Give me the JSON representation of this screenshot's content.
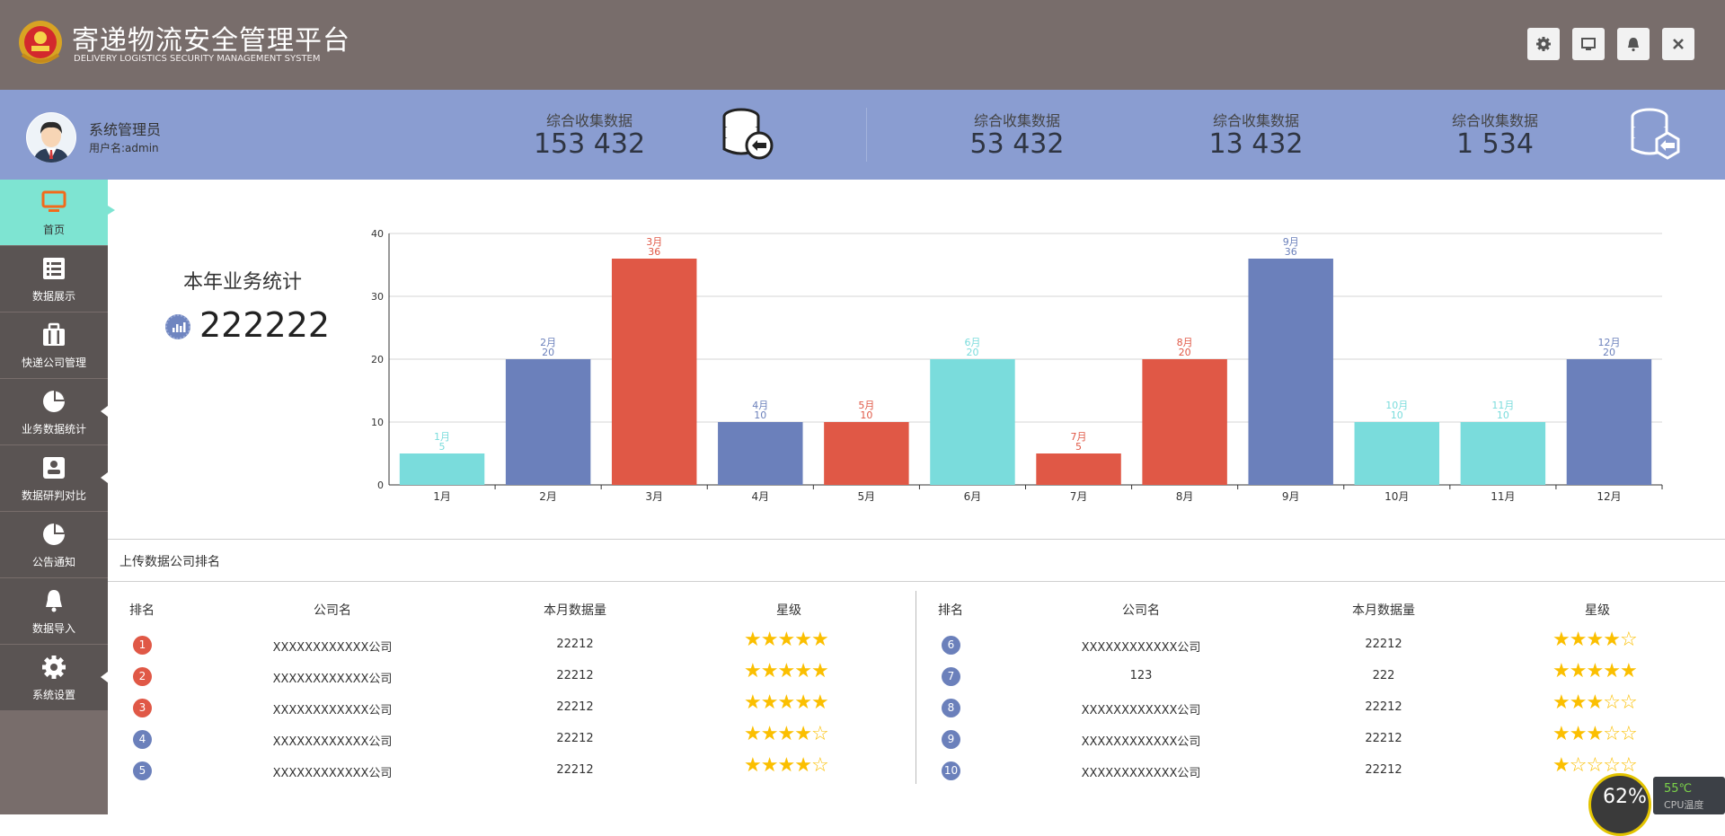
{
  "header": {
    "title": "寄递物流安全管理平台",
    "subtitle": "DELIVERY LOGISTICS SECURITY MANAGEMENT SYSTEM",
    "buttons": [
      "gear-icon",
      "monitor-icon",
      "bell-icon",
      "close-icon"
    ]
  },
  "user": {
    "name": "系统管理员",
    "login": "用户名:admin"
  },
  "stats": [
    {
      "label": "综合收集数据",
      "value": "153 432"
    },
    {
      "label": "综合收集数据",
      "value": "53 432"
    },
    {
      "label": "综合收集数据",
      "value": "13 432"
    },
    {
      "label": "综合收集数据",
      "value": "1 534"
    }
  ],
  "sidebar": {
    "items": [
      {
        "label": "首页",
        "icon": "monitor-icon",
        "active": true
      },
      {
        "label": "数据展示",
        "icon": "list-icon"
      },
      {
        "label": "快递公司管理",
        "icon": "briefcase-icon"
      },
      {
        "label": "业务数据统计",
        "icon": "pie-chart-icon"
      },
      {
        "label": "数据研判对比",
        "icon": "data-compare-icon"
      },
      {
        "label": "公告通知",
        "icon": "pie-chart-icon"
      },
      {
        "label": "数据导入",
        "icon": "bell-icon"
      },
      {
        "label": "系统设置",
        "icon": "gear-icon"
      }
    ]
  },
  "year_stats": {
    "title": "本年业务统计",
    "value": "222222"
  },
  "chart_data": {
    "type": "bar",
    "categories": [
      "1月",
      "2月",
      "3月",
      "4月",
      "5月",
      "6月",
      "7月",
      "8月",
      "9月",
      "10月",
      "11月",
      "12月"
    ],
    "values": [
      5,
      20,
      36,
      10,
      10,
      20,
      5,
      20,
      36,
      10,
      10,
      20
    ],
    "bar_colors": [
      "#7adcdc",
      "#6b80bb",
      "#e05846",
      "#6b80bb",
      "#e05846",
      "#7adcdc",
      "#e05846",
      "#e05846",
      "#6b80bb",
      "#7adcdc",
      "#7adcdc",
      "#6b80bb"
    ],
    "ylim": [
      0,
      40
    ],
    "yticks": [
      0,
      10,
      20,
      30,
      40
    ],
    "grid": true,
    "title": "",
    "xlabel": "",
    "ylabel": ""
  },
  "ranking": {
    "title": "上传数据公司排名",
    "headers": [
      "排名",
      "公司名",
      "本月数据量",
      "星级"
    ],
    "rows": [
      {
        "rank": "1",
        "company": "XXXXXXXXXXXX公司",
        "volume": "22212",
        "stars": 5,
        "badge_color": "#e05846"
      },
      {
        "rank": "2",
        "company": "XXXXXXXXXXXX公司",
        "volume": "22212",
        "stars": 5,
        "badge_color": "#e05846"
      },
      {
        "rank": "3",
        "company": "XXXXXXXXXXXX公司",
        "volume": "22212",
        "stars": 5,
        "badge_color": "#e05846"
      },
      {
        "rank": "4",
        "company": "XXXXXXXXXXXX公司",
        "volume": "22212",
        "stars": 4,
        "badge_color": "#6b80bb"
      },
      {
        "rank": "5",
        "company": "XXXXXXXXXXXX公司",
        "volume": "22212",
        "stars": 4,
        "badge_color": "#6b80bb"
      },
      {
        "rank": "6",
        "company": "XXXXXXXXXXXX公司",
        "volume": "22212",
        "stars": 4,
        "badge_color": "#6b80bb"
      },
      {
        "rank": "7",
        "company": "123",
        "volume": "222",
        "stars": 5,
        "badge_color": "#6b80bb"
      },
      {
        "rank": "8",
        "company": "XXXXXXXXXXXX公司",
        "volume": "22212",
        "stars": 3,
        "badge_color": "#6b80bb"
      },
      {
        "rank": "9",
        "company": "XXXXXXXXXXXX公司",
        "volume": "22212",
        "stars": 3,
        "badge_color": "#6b80bb"
      },
      {
        "rank": "10",
        "company": "XXXXXXXXXXXX公司",
        "volume": "22212",
        "stars": 1,
        "badge_color": "#6b80bb"
      }
    ]
  },
  "cpu": {
    "percent": "62%",
    "temperature": "55℃",
    "label": "CPU温度"
  }
}
